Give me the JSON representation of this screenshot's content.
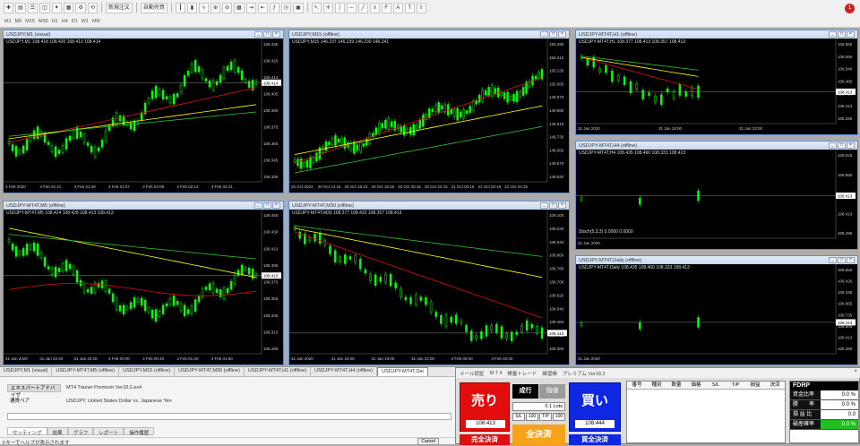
{
  "toolbar": {
    "new_order": "新規注文",
    "auto_trade": "自動売買",
    "timeframes": [
      "M1",
      "M5",
      "M15",
      "M30",
      "H1",
      "H4",
      "D1",
      "W1",
      "MN"
    ],
    "notification_count": "1"
  },
  "charts": [
    {
      "title": "USDJPY,M1 (visual)",
      "header": "USDJPY,M1  108.418 108.420 108.413 108.414",
      "prices": [
        "108.435",
        "108.420",
        "108.414",
        "108.405",
        "108.390",
        "108.375",
        "108.360",
        "108.345",
        "108.330"
      ],
      "price_tag": "108.414",
      "times": [
        "3 Feb 2020",
        "3 Feb 01:41",
        "3 Feb 01:49",
        "3 Feb 01:57",
        "3 Feb 02:05",
        "3 Feb 02:13",
        "3 Feb 02:21"
      ]
    },
    {
      "title": "USDJPY,M15 (offline)",
      "header": "USDJPY,M15  146.237 146.239 146.230 146.241",
      "prices": [
        "150.290",
        "150.210",
        "150.130",
        "150.050",
        "149.970",
        "149.890",
        "149.810",
        "149.730",
        "149.650",
        "149.570",
        "149.530"
      ],
      "price_tag": "",
      "times": [
        "20 Oct 2022",
        "20 Oct 14:15",
        "20 Oct 16:15",
        "20 Oct 18:15",
        "20 Oct 20:15",
        "20 Oct 22:15",
        "21 Oct 00:15",
        "21 Oct 02:15",
        "21 Oct 04:15"
      ]
    },
    {
      "title": "USDJPY-MT4T,H1 (offline)",
      "header": "USDJPY-MT4T,H1  108.377 108.413 108.357 108.413",
      "prices": [
        "108.650",
        "108.595",
        "108.540",
        "108.485",
        "108.430",
        "108.413",
        "108.290"
      ],
      "price_tag": "108.413",
      "times": [
        "31 Jan 2020",
        "31 Jan 15:00",
        "31 Jan 23:00"
      ]
    },
    {
      "title": "USDJPY-MT4T,H4 (offline)",
      "header": "USDJPY-MT4T,H4  108.435 108.460 108.333 108.413",
      "prices": [
        "109.025",
        "108.685",
        "108.545",
        "108.413",
        "108.295"
      ],
      "price_tag": "108.413",
      "times": [
        "31 Jan 2020"
      ],
      "sub_header": "Stoch(5,3,3) 0.0000 0.0000"
    },
    {
      "title": "USDJPY-MT4T,M5 (offline)",
      "header": "USDJPY-MT4T,M5  108.424 108.428 108.413 108.413",
      "prices": [
        "108.455",
        "108.430",
        "108.413",
        "108.395",
        "108.375",
        "108.355",
        "108.335",
        "108.315",
        "108.295"
      ],
      "price_tag": "108.413",
      "times": [
        "31 Jan 2020",
        "31 Jan 22:40",
        "31 Jan 23:20",
        "3 Feb 00:00",
        "3 Feb 00:40",
        "3 Feb 01:20",
        "3 Feb 01:50"
      ]
    },
    {
      "title": "USDJPY-MT4T,M30 (offline)",
      "header": "USDJPY-MT4T,M30  108.377 108.432 108.357 108.413",
      "prices": [
        "109.100",
        "109.020",
        "108.940",
        "108.860",
        "108.780",
        "108.700",
        "108.620",
        "108.540",
        "108.460",
        "108.413",
        "108.380"
      ],
      "price_tag": "108.413",
      "times": [
        "31 Jan 2020",
        "31 Jan 15:00",
        "31 Jan 19:00",
        "31 Jan 23:00",
        "3 Feb 00:00",
        "3 Feb 02:00"
      ]
    },
    {
      "title": "USDJPY-MT4T,Daily (offline)",
      "header": "USDJPY-MT4T,Daily  108.435 108.460 108.333 108.413",
      "prices": [
        "109.650",
        "109.425",
        "109.195",
        "108.965",
        "108.735",
        "108.505",
        "108.413",
        "108.280"
      ],
      "price_tag": "108.413",
      "times": [
        "31 Jan 2020"
      ]
    }
  ],
  "chart_tabs": [
    "USDJPY,M1 (visual)",
    "USDJPY-MT4T,M5 (offline)",
    "USDJPY,M15 (offline)",
    "USDJPY-MT4T,M30 (offline)",
    "USDJPY-MT4T,H1 (offline)",
    "USDJPY-MT4T,H4 (offline)",
    "USDJPY-MT4T,Dai"
  ],
  "tester": {
    "ea_label": "エキスパートアドバイザ",
    "ea_value": "MT4 Trainer Premium Ver18.2.ex4",
    "symbol_label": "通貨ペア",
    "symbol_value": "USDJPY, United States Dollar vs. Japanese Yen",
    "tabs": [
      "セッティング",
      "結果",
      "グラフ",
      "レポート",
      "操作履歴"
    ],
    "status": "Fキーでヘルプが表示されます",
    "cancel": "Cancel"
  },
  "trade_panel": {
    "menu": [
      "メール認証",
      "M T 4",
      "検量トレード",
      "練習帳",
      "プレミアム Ver18.2"
    ],
    "close": "×",
    "sell_label": "売り",
    "sell_price": "108.413",
    "buy_label": "買い",
    "buy_price": "108.444",
    "market_label": "成行",
    "limit_label": "指値",
    "lots": "0.1 Lots",
    "sl_label": "S/L",
    "sl_value": "100",
    "tp_label": "T/P",
    "tp_value": "100",
    "sell_all": "売全決済",
    "all_close": "全決済",
    "buy_all": "買全決済",
    "order_headers": [
      "番号",
      "種別",
      "数量",
      "価格",
      "S/L",
      "T/P",
      "損益",
      "決済"
    ],
    "fdrp": {
      "title": "FDRP",
      "rows": [
        {
          "k": "資金比率",
          "v": "0.0 %"
        },
        {
          "k": "勝　　率",
          "v": "0.0 %"
        },
        {
          "k": "損 益 比",
          "v": "0.0"
        },
        {
          "k": "破産確率",
          "v": "0.0 %"
        }
      ]
    }
  },
  "colors": {
    "candle": "#00ff00",
    "ma_red": "#e01010",
    "ma_yellow": "#ffff00",
    "ma_green": "#30c030",
    "sell": "#e20e0e",
    "buy": "#0d27e2",
    "close_all": "#f7a21b"
  }
}
